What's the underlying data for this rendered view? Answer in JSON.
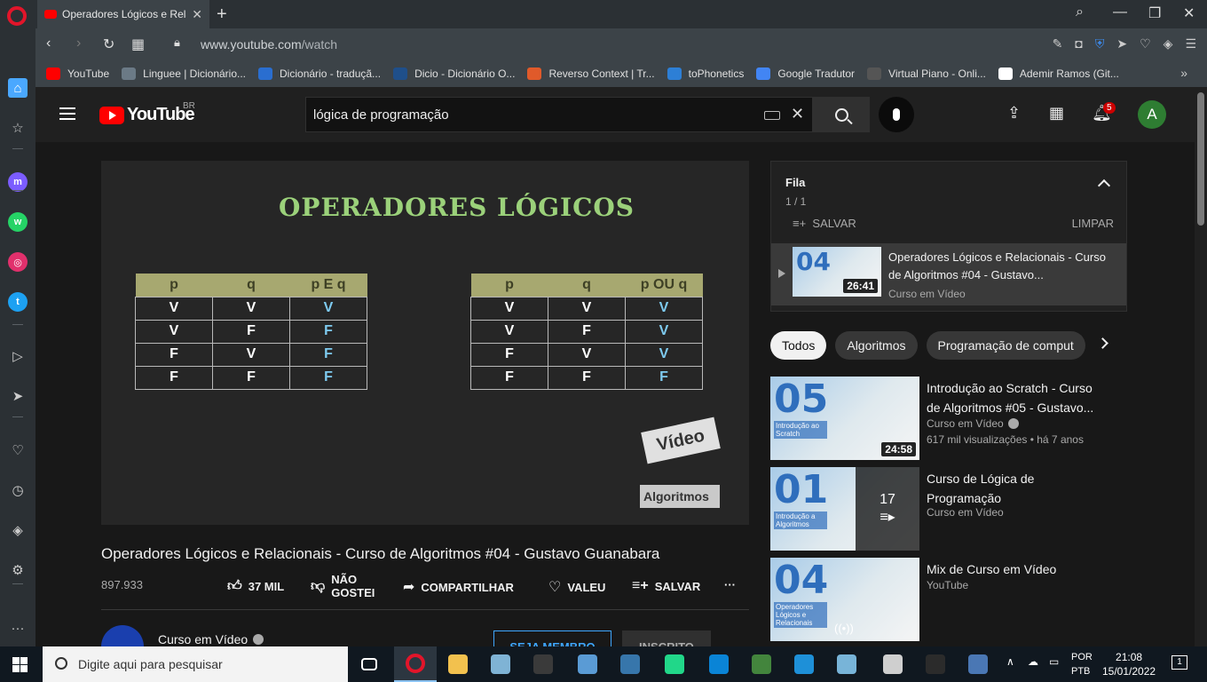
{
  "browser": {
    "tab_title": "Operadores Lógicos e Relac",
    "url_host": "www.youtube.com",
    "url_path": "/watch",
    "bookmarks": [
      {
        "label": "YouTube",
        "color": "#ff0000"
      },
      {
        "label": "Linguee | Dicionário...",
        "color": "#6b7a86"
      },
      {
        "label": "Dicionário - traduçã...",
        "color": "#2a6ed0"
      },
      {
        "label": "Dicio - Dicionário O...",
        "color": "#1f4f8a"
      },
      {
        "label": "Reverso Context | Tr...",
        "color": "#e05a2a"
      },
      {
        "label": "toPhonetics",
        "color": "#2d7fd6"
      },
      {
        "label": "Google Tradutor",
        "color": "#4285f4"
      },
      {
        "label": "Virtual Piano - Onli...",
        "color": "#555555"
      },
      {
        "label": "Ademir Ramos (Git...",
        "color": "#ffffff"
      }
    ]
  },
  "sidebar_icons": [
    {
      "name": "home-icon",
      "color": "#4aa8ff",
      "glyph": "⌂"
    },
    {
      "name": "speed-dial-icon",
      "color": "#cccccc",
      "glyph": "☆"
    },
    {
      "name": "messenger-icon",
      "color": "#7b5cff",
      "glyph": "m"
    },
    {
      "name": "whatsapp-icon",
      "color": "#25d366",
      "glyph": "w"
    },
    {
      "name": "instagram-icon",
      "color": "#e1306c",
      "glyph": "◎"
    },
    {
      "name": "twitter-icon",
      "color": "#1da1f2",
      "glyph": "t"
    },
    {
      "name": "player-icon",
      "color": "#cccccc",
      "glyph": "▷"
    },
    {
      "name": "send-icon",
      "color": "#cccccc",
      "glyph": "➤"
    },
    {
      "name": "heart-icon",
      "color": "#cccccc",
      "glyph": "♡"
    },
    {
      "name": "history-icon",
      "color": "#cccccc",
      "glyph": "◷"
    },
    {
      "name": "cube-icon",
      "color": "#cccccc",
      "glyph": "◈"
    },
    {
      "name": "settings-icon",
      "color": "#cccccc",
      "glyph": "⚙"
    },
    {
      "name": "more-icon",
      "color": "#cccccc",
      "glyph": "···"
    }
  ],
  "youtube": {
    "logo_text": "YouTube",
    "country": "BR",
    "search_query": "lógica de programação",
    "notifications": "5",
    "avatar_letter": "A"
  },
  "video": {
    "slide_title": "OPERADORES LÓGICOS",
    "table_and": {
      "headers": [
        "p",
        "q",
        "p E q"
      ],
      "rows": [
        [
          "V",
          "V",
          "V"
        ],
        [
          "V",
          "F",
          "F"
        ],
        [
          "F",
          "V",
          "F"
        ],
        [
          "F",
          "F",
          "F"
        ]
      ]
    },
    "table_or": {
      "headers": [
        "p",
        "q",
        "p OU q"
      ],
      "rows": [
        [
          "V",
          "V",
          "V"
        ],
        [
          "V",
          "F",
          "V"
        ],
        [
          "F",
          "V",
          "V"
        ],
        [
          "F",
          "F",
          "F"
        ]
      ]
    },
    "watermark_top": "Vídeo",
    "watermark_bottom": "Algoritmos",
    "title": "Operadores Lógicos e Relacionais - Curso de Algoritmos #04 - Gustavo Guanabara",
    "views": "897.933",
    "likes": "37 MIL",
    "dislike": "NÃO GOSTEI",
    "share": "COMPARTILHAR",
    "thanks": "VALEU",
    "save": "SALVAR",
    "channel": "Curso em Vídeo",
    "join": "SEJA MEMBRO",
    "subscribed": "INSCRITO"
  },
  "queue": {
    "title": "Fila",
    "count": "1 / 1",
    "save": "SALVAR",
    "clear": "LIMPAR",
    "item": {
      "title": "Operadores Lógicos e Relacionais - Curso de Algoritmos #04 - Gustavo...",
      "channel": "Curso em Vídeo",
      "duration": "26:41",
      "number": "04"
    }
  },
  "chips": [
    "Todos",
    "Algoritmos",
    "Programação de comput"
  ],
  "recommended": [
    {
      "title": "Introdução ao Scratch - Curso de Algoritmos #05 - Gustavo...",
      "channel": "Curso em Vídeo",
      "meta": "617 mil visualizações • há 7 anos",
      "duration": "24:58",
      "number": "05",
      "subtitle": "Introdução ao Scratch"
    },
    {
      "title": "Curso de Lógica de Programação",
      "channel": "Curso em Vídeo",
      "playlist_count": "17",
      "number": "01",
      "subtitle": "Introdução a Algoritmos"
    },
    {
      "title": "Mix de Curso em Vídeo",
      "channel": "YouTube",
      "number": "04",
      "subtitle": "Operadores Lógicos e Relacionais"
    }
  ],
  "taskbar": {
    "search_placeholder": "Digite aqui para pesquisar",
    "lang_top": "POR",
    "lang_bottom": "PTB",
    "time": "21:08",
    "date": "15/01/2022",
    "notif_count": "1",
    "apps": [
      {
        "name": "task-view-icon",
        "color": "#101820"
      },
      {
        "name": "opera-app-icon",
        "color": "#e2152a"
      },
      {
        "name": "file-explorer-icon",
        "color": "#f2c14e"
      },
      {
        "name": "paint-app-icon",
        "color": "#7fb3d5"
      },
      {
        "name": "game-app-icon",
        "color": "#3a3a3a"
      },
      {
        "name": "grid-app-icon",
        "color": "#5a9bd5"
      },
      {
        "name": "python-app-icon",
        "color": "#3776ab"
      },
      {
        "name": "pycharm-app-icon",
        "color": "#21d789"
      },
      {
        "name": "vscode-app-icon",
        "color": "#0a84d6"
      },
      {
        "name": "nodejs-app-icon",
        "color": "#43853d"
      },
      {
        "name": "bird-app-icon",
        "color": "#1e90d8"
      },
      {
        "name": "notes-app-icon",
        "color": "#78b4d8"
      },
      {
        "name": "settings-app-icon",
        "color": "#cfcfcf"
      },
      {
        "name": "terminal-app-icon",
        "color": "#2b2b2b"
      },
      {
        "name": "network-app-icon",
        "color": "#4a77b4"
      }
    ]
  }
}
